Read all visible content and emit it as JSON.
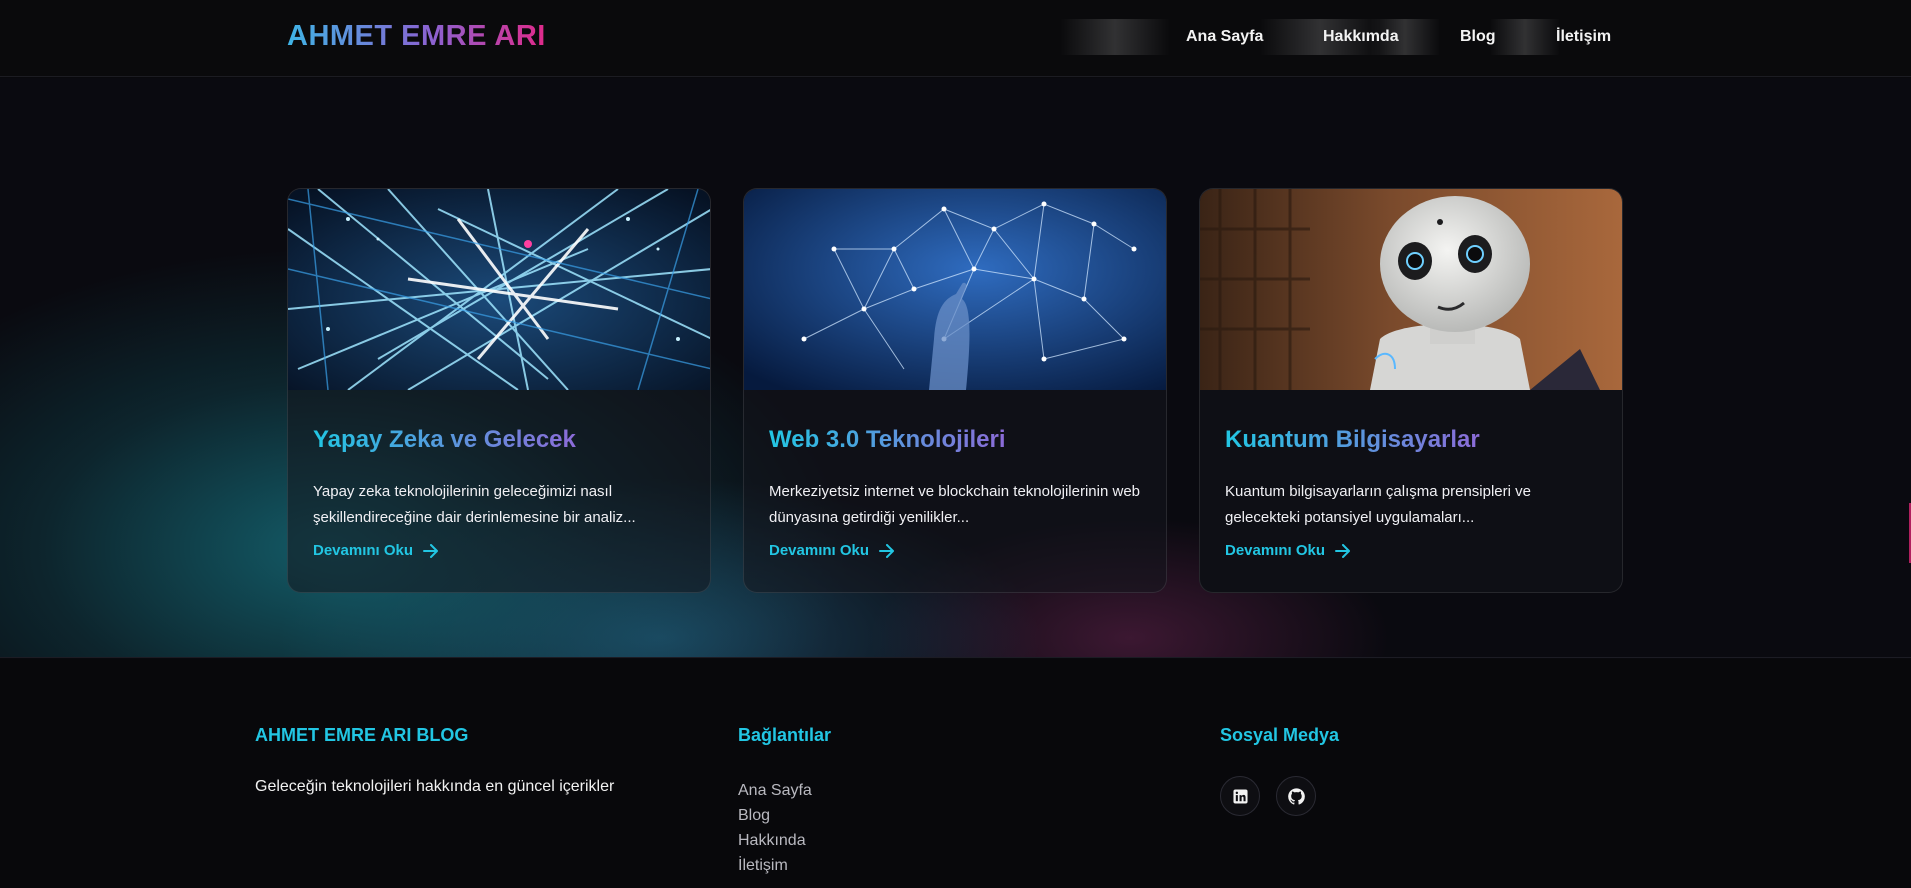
{
  "header": {
    "logo": "AHMET EMRE ARI",
    "nav": [
      {
        "label": "Ana Sayfa"
      },
      {
        "label": "Hakkımda"
      },
      {
        "label": "Blog"
      },
      {
        "label": "İletişim"
      }
    ]
  },
  "cards": [
    {
      "title": "Yapay Zeka ve Gelecek",
      "description": "Yapay zeka teknolojilerinin geleceğimizi nasıl şekillendireceğine dair derinlemesine bir analiz...",
      "link": "Devamını Oku",
      "image": "fiber-optic-light-streaks"
    },
    {
      "title": "Web 3.0 Teknolojileri",
      "description": "Merkeziyetsiz internet ve blockchain teknolojilerinin web dünyasına getirdiği yenilikler...",
      "link": "Devamını Oku",
      "image": "network-hand-blue"
    },
    {
      "title": "Kuantum Bilgisayarlar",
      "description": "Kuantum bilgisayarların çalışma prensipleri ve gelecekteki potansiyel uygulamaları...",
      "link": "Devamını Oku",
      "image": "white-humanoid-robot"
    }
  ],
  "footer": {
    "brand": {
      "title": "AHMET EMRE ARI BLOG",
      "text": "Geleceğin teknolojileri hakkında en güncel içerikler"
    },
    "links": {
      "title": "Bağlantılar",
      "items": [
        "Ana Sayfa",
        "Blog",
        "Hakkında",
        "İletişim"
      ]
    },
    "social": {
      "title": "Sosyal Medya",
      "icons": [
        "linkedin-icon",
        "github-icon"
      ]
    }
  },
  "colors": {
    "accent": "#22c6e3",
    "purple": "#8c6bd8",
    "pink": "#e02a8a"
  }
}
